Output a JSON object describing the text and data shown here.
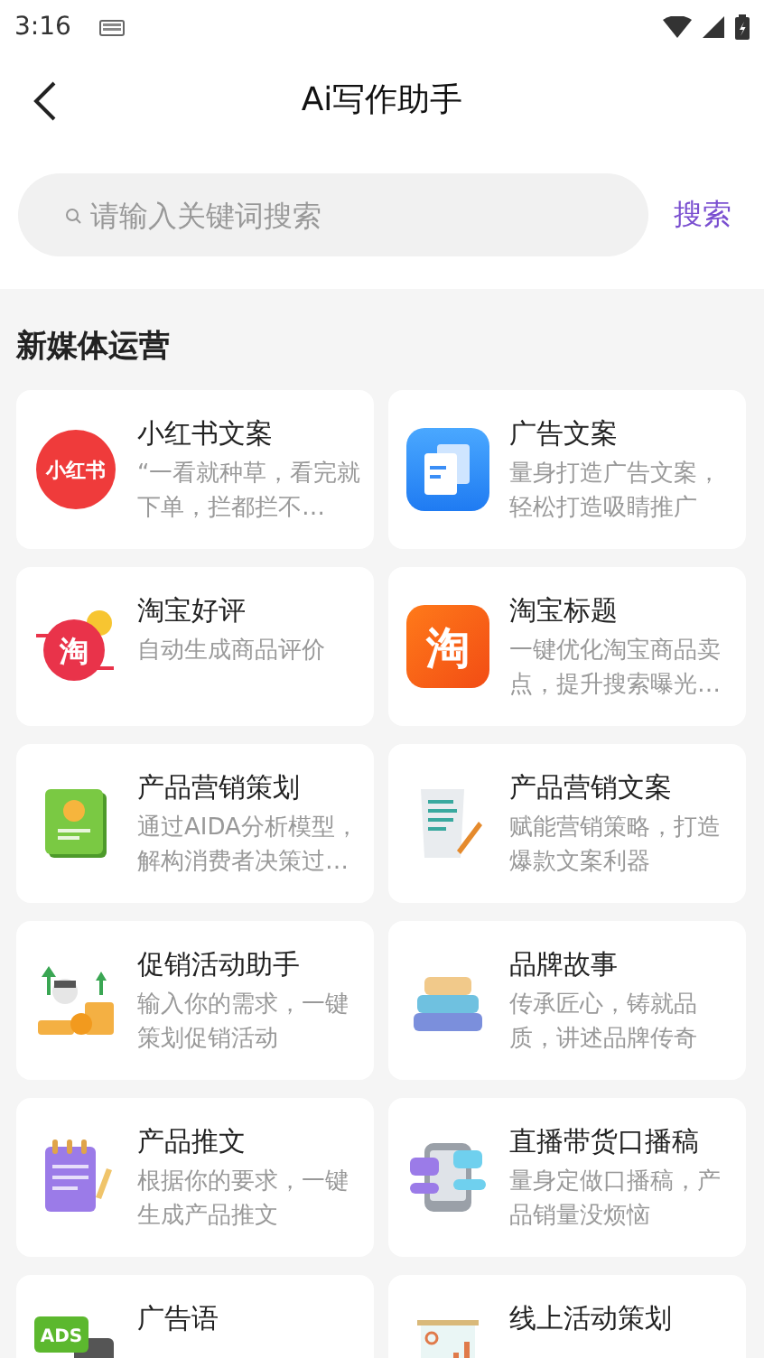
{
  "status_bar": {
    "time": "3:16"
  },
  "header": {
    "title": "Ai写作助手"
  },
  "search": {
    "placeholder": "请输入关键词搜索",
    "button": "搜索"
  },
  "section": {
    "title": "新媒体运营",
    "items": [
      {
        "title": "小红书文案",
        "desc": "“一看就种草，看完就下单，拦都拦不…",
        "icon": {
          "kind": "xhs",
          "text": "小红书"
        }
      },
      {
        "title": "广告文案",
        "desc": "量身打造广告文案，轻松打造吸睛推广",
        "icon": {
          "kind": "doc"
        }
      },
      {
        "title": "淘宝好评",
        "desc": "自动生成商品评价",
        "icon": {
          "kind": "taobao-round",
          "text": "淘"
        }
      },
      {
        "title": "淘宝标题",
        "desc": "一键优化淘宝商品卖点，提升搜索曝光…",
        "icon": {
          "kind": "taobao-square",
          "text": "淘"
        }
      },
      {
        "title": "产品营销策划",
        "desc": "通过AIDA分析模型，解构消费者决策过…",
        "icon": {
          "kind": "book"
        }
      },
      {
        "title": "产品营销文案",
        "desc": "赋能营销策略，打造爆款文案利器",
        "icon": {
          "kind": "letter"
        }
      },
      {
        "title": "促销活动助手",
        "desc": "输入你的需求，一键策划促销活动",
        "icon": {
          "kind": "promo"
        }
      },
      {
        "title": "品牌故事",
        "desc": "传承匠心，铸就品质，讲述品牌传奇",
        "icon": {
          "kind": "books"
        }
      },
      {
        "title": "产品推文",
        "desc": "根据你的要求，一键生成产品推文",
        "icon": {
          "kind": "notepad"
        }
      },
      {
        "title": "直播带货口播稿",
        "desc": "量身定做口播稿，产品销量没烦恼",
        "icon": {
          "kind": "phone"
        }
      },
      {
        "title": "广告语",
        "icon": {
          "kind": "ads",
          "text": "ADS"
        }
      },
      {
        "title": "线上活动策划",
        "icon": {
          "kind": "board"
        }
      }
    ]
  }
}
